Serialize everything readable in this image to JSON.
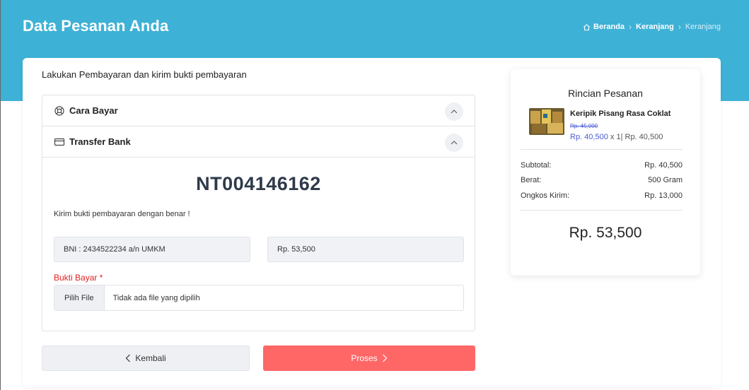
{
  "header": {
    "title": "Data Pesanan Anda",
    "breadcrumb": {
      "home": "Beranda",
      "cart": "Keranjang",
      "current": "Keranjang"
    }
  },
  "payment": {
    "intro": "Lakukan Pembayaran dan kirim bukti pembayaran",
    "sections": {
      "how_to_pay": "Cara Bayar",
      "bank_transfer": "Transfer Bank"
    },
    "order_code": "NT004146162",
    "note": "Kirim bukti pembayaran dengan benar !",
    "bank_account": "BNI : 2434522234 a/n UMKM",
    "amount": "Rp. 53,500",
    "proof_label": "Bukti Bayar",
    "proof_required_mark": "*",
    "file_button": "Pilih File",
    "file_status": "Tidak ada file yang dipilih"
  },
  "actions": {
    "back_label": "Kembali",
    "process_label": "Proses"
  },
  "summary": {
    "title": "Rincian Pesanan",
    "item": {
      "name": "Keripik Pisang Rasa Coklat",
      "old_price": "Rp. 45,000",
      "price": "Rp. 40,500",
      "qty": "x 1",
      "line_total": "Rp. 40,500"
    },
    "rows": {
      "subtotal_label": "Subtotal:",
      "subtotal_value": "Rp. 40,500",
      "weight_label": "Berat:",
      "weight_value": "500 Gram",
      "shipping_label": "Ongkos Kirim:",
      "shipping_value": "Rp. 13,000"
    },
    "total": "Rp. 53,500"
  },
  "colors": {
    "header_bg": "#3eb1d6",
    "accent_blue": "#4a5bd4",
    "process_button": "#ff6767",
    "required_red": "#e02020"
  }
}
